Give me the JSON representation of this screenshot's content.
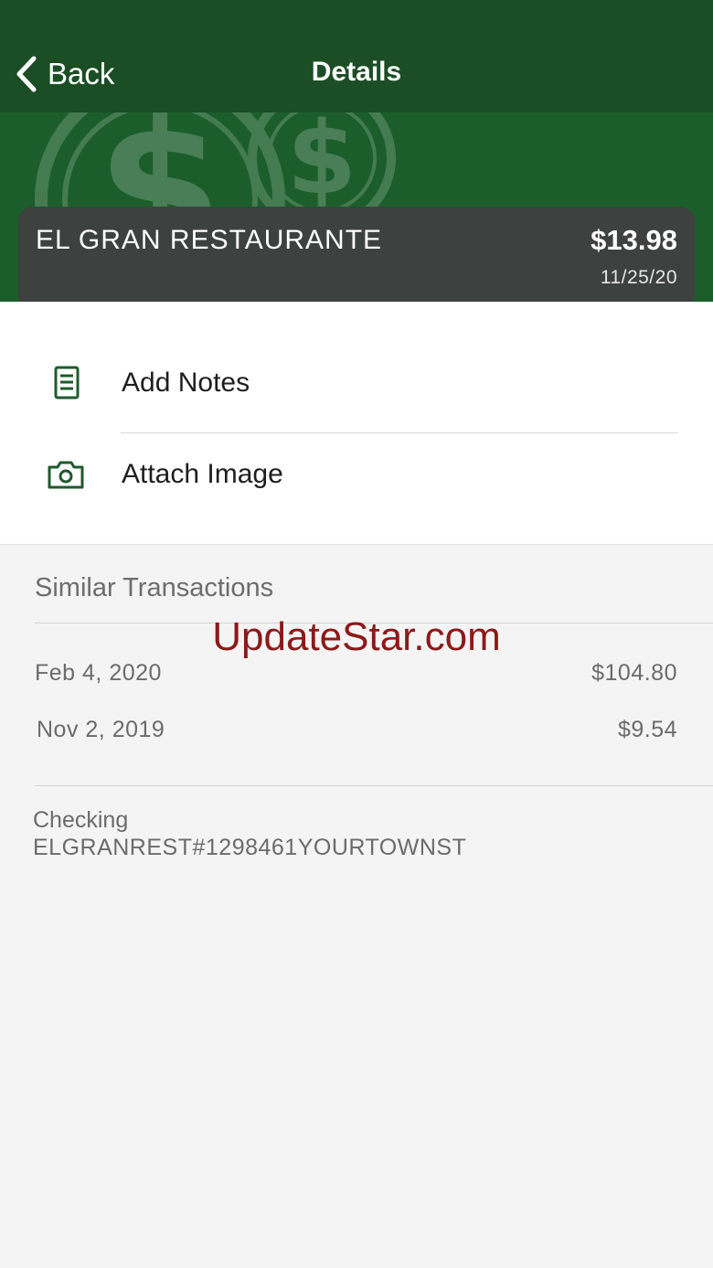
{
  "nav": {
    "back_label": "Back",
    "title": "Details"
  },
  "transaction": {
    "merchant": "EL GRAN RESTAURANTE",
    "amount": "$13.98",
    "date": "11/25/20"
  },
  "actions": [
    {
      "label": "Add Notes",
      "icon": "notes-icon"
    },
    {
      "label": "Attach Image",
      "icon": "camera-icon"
    }
  ],
  "similar": {
    "title": "Similar Transactions",
    "rows": [
      {
        "date": "Feb 4, 2020",
        "amount": "$104.80"
      },
      {
        "date": "Nov 2, 2019",
        "amount": "$9.54"
      }
    ]
  },
  "account": {
    "name": "Checking",
    "description": "ELGRANREST#1298461YOURTOWNST"
  },
  "watermark": "UpdateStar.com",
  "colors": {
    "navbar": "#1c4e26",
    "hero": "#1b5e2b",
    "card": "#3d413f",
    "accent": "#1f5a2e",
    "watermark": "#8b1a1a"
  }
}
